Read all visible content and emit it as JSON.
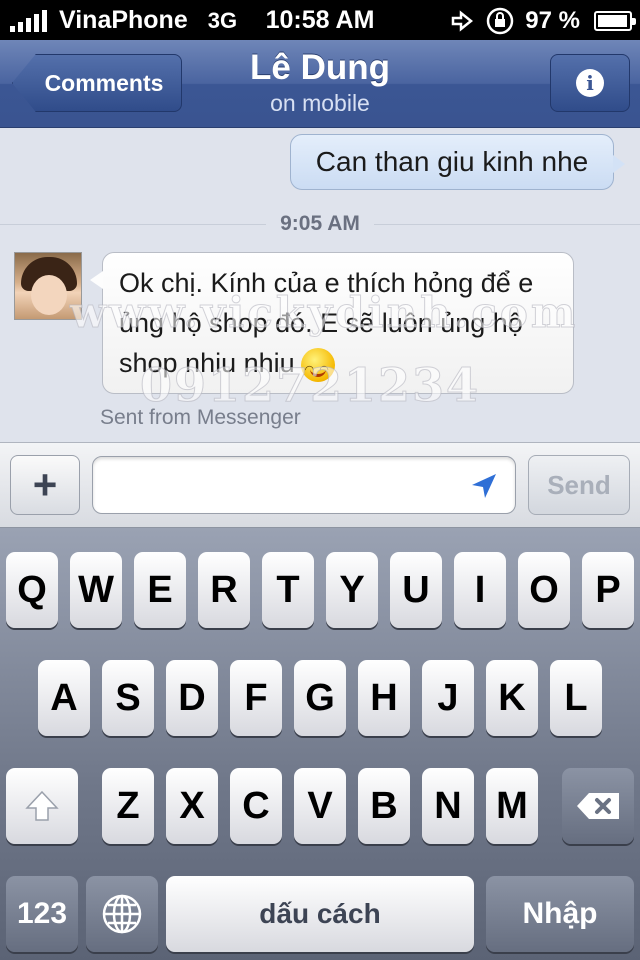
{
  "status_bar": {
    "carrier": "VinaPhone",
    "network": "3G",
    "time": "10:58 AM",
    "battery": "97 %",
    "battery_level": 0.97
  },
  "nav": {
    "back_label": "Comments",
    "title": "Lê Dung",
    "subtitle": "on mobile"
  },
  "chat": {
    "outgoing": "Can than giu kinh nhe",
    "timestamp": "9:05 AM",
    "incoming": "Ok chị. Kính của e thích hỏng để e ủng hộ shop đó. E sẽ luôn ủng hộ shop nhiu nhiu",
    "sent_from": "Sent from Messenger",
    "watermark_1": "www.vickydinh.com",
    "watermark_2": "0912721234"
  },
  "input": {
    "plus_label": "+",
    "placeholder": "",
    "send_label": "Send"
  },
  "keyboard": {
    "row1": [
      "Q",
      "W",
      "E",
      "R",
      "T",
      "Y",
      "U",
      "I",
      "O",
      "P"
    ],
    "row2": [
      "A",
      "S",
      "D",
      "F",
      "G",
      "H",
      "J",
      "K",
      "L"
    ],
    "row3": [
      "Z",
      "X",
      "C",
      "V",
      "B",
      "N",
      "M"
    ],
    "numbers_label": "123",
    "space_label": "dấu cách",
    "return_label": "Nhập"
  }
}
